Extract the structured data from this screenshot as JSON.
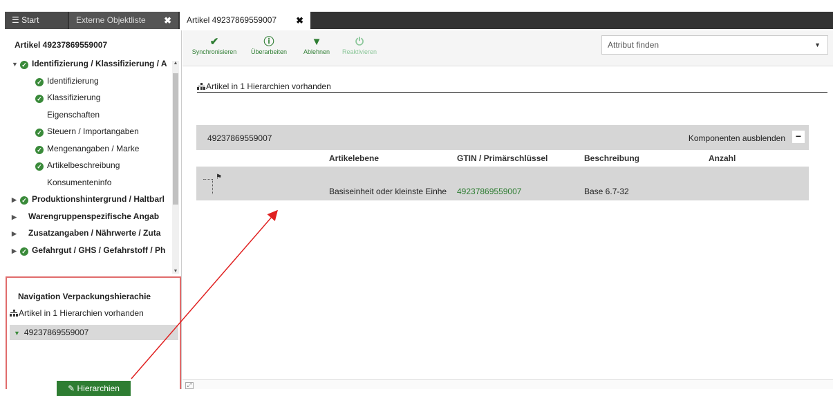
{
  "tabs": [
    {
      "label": "Start",
      "icon": "menu-icon"
    },
    {
      "label": "Externe Objektliste",
      "close": "✖"
    },
    {
      "label": "Artikel 49237869559007",
      "close": "✖"
    }
  ],
  "sidebar": {
    "title": "Artikel 49237869559007",
    "tree": [
      {
        "label": "Identifizierung / Klassifizierung / A",
        "bold": true,
        "caret": "down",
        "check": true
      },
      {
        "label": "Identifizierung",
        "check": true
      },
      {
        "label": "Klassifizierung",
        "check": true
      },
      {
        "label": "Eigenschaften",
        "check": false
      },
      {
        "label": "Steuern / Importangaben",
        "check": true
      },
      {
        "label": "Mengenangaben / Marke",
        "check": true
      },
      {
        "label": "Artikelbeschreibung",
        "check": true
      },
      {
        "label": "Konsumenteninfo",
        "check": false
      },
      {
        "label": "Produktionshintergrund / Haltbarl",
        "bold": true,
        "caret": "right",
        "check": true
      },
      {
        "label": "Warengruppenspezifische Angab",
        "bold": true,
        "caret": "right",
        "check": false
      },
      {
        "label": "Zusatzangaben / Nährwerte / Zuta",
        "bold": true,
        "caret": "right",
        "check": false
      },
      {
        "label": "Gefahrgut / GHS / Gefahrstoff / Ph",
        "bold": true,
        "caret": "right",
        "check": true
      }
    ]
  },
  "nav": {
    "title": "Navigation Verpackungshierachie",
    "hier_text": "Artikel in 1 Hierarchien vorhanden",
    "selected": "49237869559007",
    "button": "Hierarchien"
  },
  "toolbar": {
    "buttons": [
      {
        "label": "Synchronisieren",
        "icon": "checkmark-icon",
        "glyph": "✔",
        "enabled": true
      },
      {
        "label": "Überarbeiten",
        "icon": "exclamation-icon",
        "glyph": "❗",
        "enabled": true
      },
      {
        "label": "Ablehnen",
        "icon": "thumbs-down-icon",
        "glyph": "👎",
        "enabled": true
      },
      {
        "label": "Reaktivieren",
        "icon": "power-icon",
        "glyph": "⏻",
        "enabled": false
      }
    ],
    "search_placeholder": "Attribut finden"
  },
  "main": {
    "hier_text": "Artikel in 1 Hierarchien vorhanden",
    "grid": {
      "id": "49237869559007",
      "toggle_label": "Komponenten ausblenden",
      "columns": [
        "Artikelebene",
        "GTIN / Primärschlüssel",
        "Beschreibung",
        "Anzahl"
      ],
      "rows": [
        {
          "ebene": "Basiseinheit oder kleinste Einhe",
          "gtin": "49237869559007",
          "beschreibung": "Base 6.7-32",
          "anzahl": ""
        }
      ]
    }
  },
  "colors": {
    "accent": "#2e7d32",
    "highlight_border": "#e06b6b",
    "arrow": "#e02020"
  }
}
